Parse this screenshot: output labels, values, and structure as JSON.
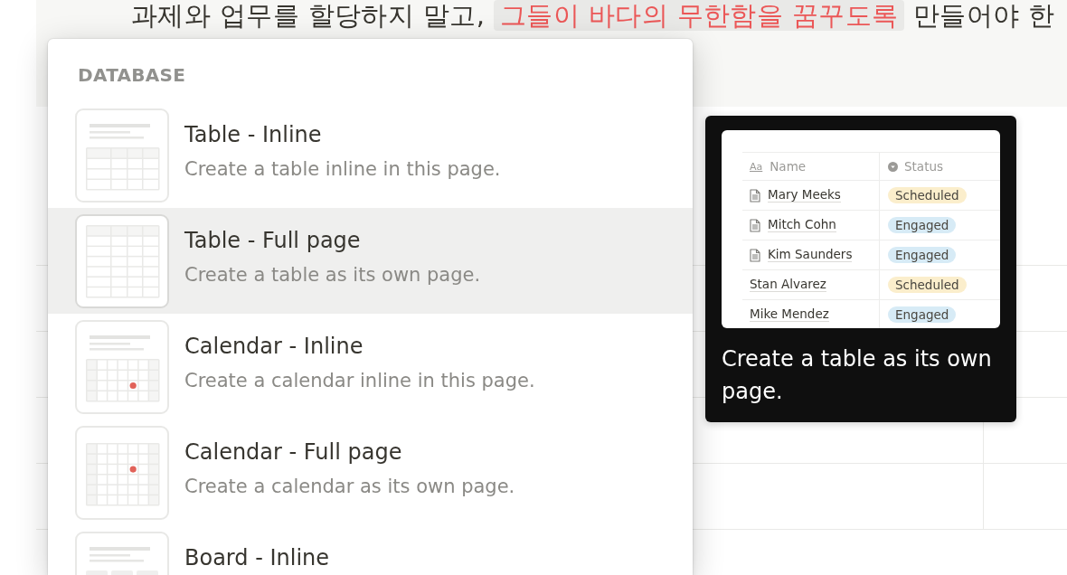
{
  "page": {
    "callout": {
      "segments": [
        {
          "text": "과제와 업무를 할당하지 말고,",
          "highlighted": false
        },
        {
          "text": "그들이 바다의 무한함을 꿈꾸도록",
          "highlighted": true
        },
        {
          "text": "만들어야 한",
          "highlighted": false
        }
      ]
    }
  },
  "menu": {
    "header": "DATABASE",
    "items": [
      {
        "kind": "table_inline",
        "title": "Table - Inline",
        "description": "Create a table inline in this page.",
        "selected": false
      },
      {
        "kind": "table_full",
        "title": "Table - Full page",
        "description": "Create a table as its own page.",
        "selected": true
      },
      {
        "kind": "calendar_inline",
        "title": "Calendar - Inline",
        "description": "Create a calendar inline in this page.",
        "selected": false
      },
      {
        "kind": "calendar_full",
        "title": "Calendar - Full page",
        "description": "Create a calendar as its own page.",
        "selected": false
      },
      {
        "kind": "board_inline",
        "title": "Board - Inline",
        "selected": false
      }
    ]
  },
  "tooltip": {
    "preview": {
      "columns": [
        {
          "kind": "text",
          "icon": "Aa",
          "label": "Name"
        },
        {
          "kind": "select",
          "label": "Status"
        }
      ],
      "rows": [
        {
          "name": "Mary Meeks",
          "page_icon": true,
          "status": "Scheduled",
          "color": "#fbeecc"
        },
        {
          "name": "Mitch Cohn",
          "page_icon": true,
          "status": "Engaged",
          "color": "#d7ebf6"
        },
        {
          "name": "Kim Saunders",
          "page_icon": true,
          "status": "Engaged",
          "color": "#d7ebf6"
        },
        {
          "name": "Stan Alvarez",
          "page_icon": false,
          "status": "Scheduled",
          "color": "#fbeecc"
        },
        {
          "name": "Mike Mendez",
          "page_icon": false,
          "status": "Engaged",
          "color": "#d7ebf6"
        }
      ]
    },
    "text": "Create a table as its own page."
  }
}
